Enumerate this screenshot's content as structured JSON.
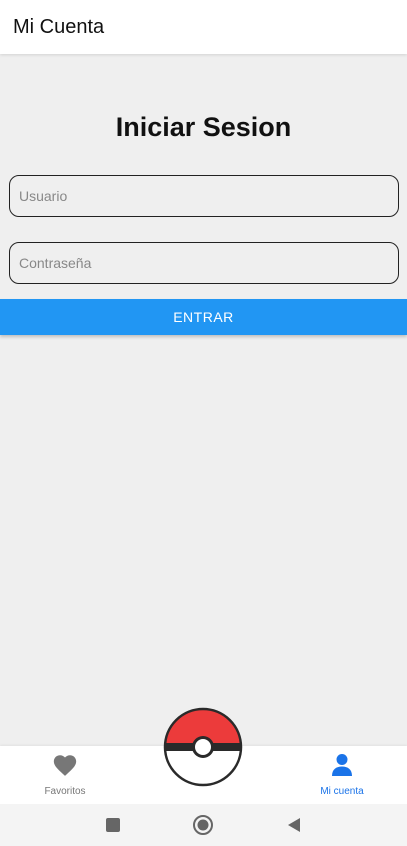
{
  "app_bar": {
    "title": "Mi Cuenta"
  },
  "login": {
    "title": "Iniciar Sesion",
    "user_placeholder": "Usuario",
    "password_placeholder": "Contraseña",
    "enter_label": "ENTRAR"
  },
  "bottom_nav": {
    "items": [
      {
        "label": "Favoritos",
        "icon": "heart-icon",
        "active": false
      },
      {
        "label": "Mi cuenta",
        "icon": "person-icon",
        "active": true
      }
    ],
    "center_icon": "pokeball-icon"
  },
  "system_nav": {
    "buttons": [
      "recent-apps-icon",
      "home-icon",
      "back-icon"
    ]
  },
  "colors": {
    "accent": "#2196f3",
    "active_nav": "#1a73e8",
    "background": "#efefef",
    "pokeball_red": "#ec3b3b"
  }
}
